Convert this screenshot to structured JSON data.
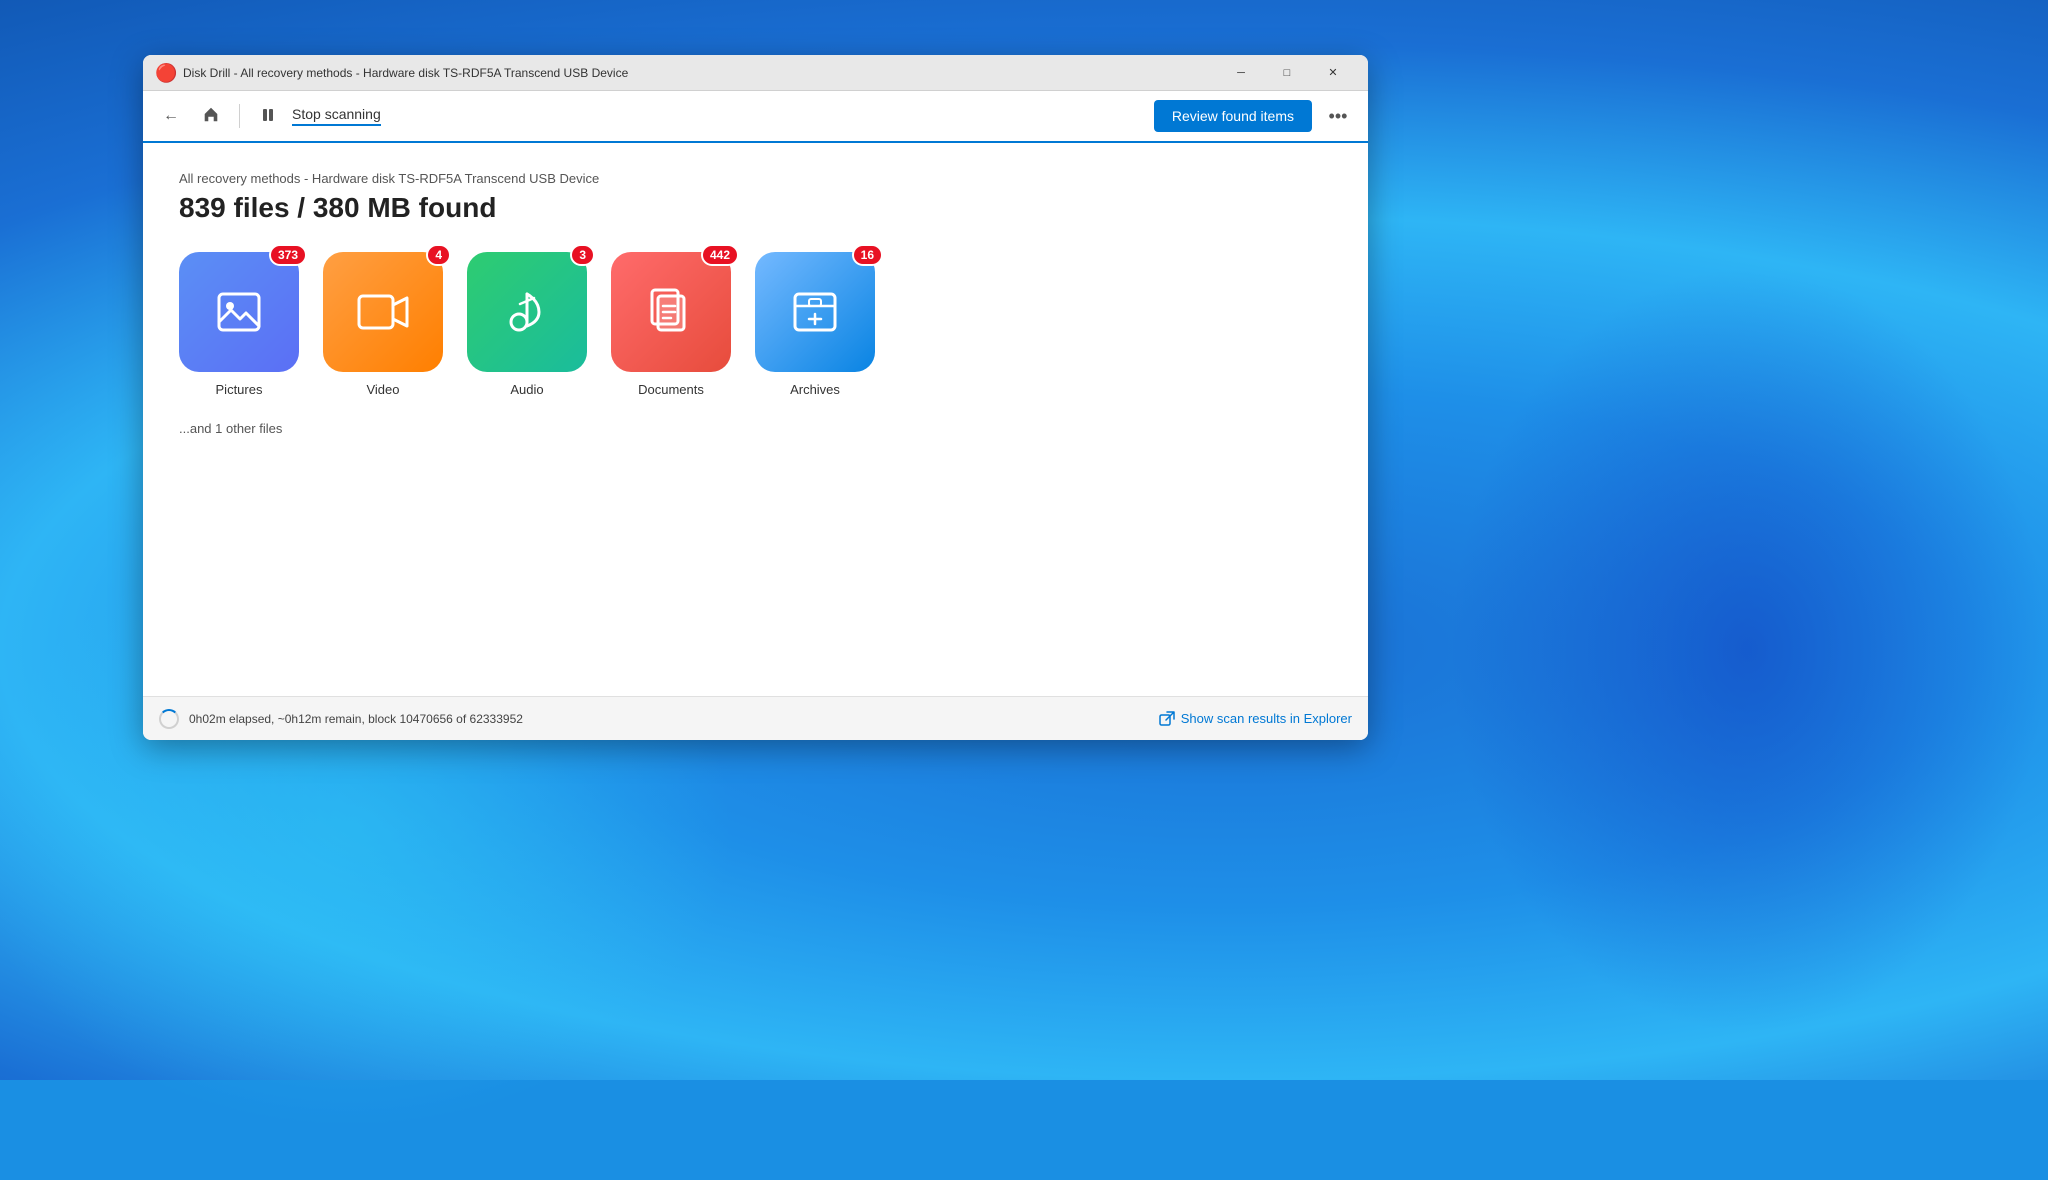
{
  "window": {
    "title": "Disk Drill - All recovery methods - Hardware disk TS-RDF5A Transcend USB Device",
    "app_icon": "🔴",
    "minimize_label": "─",
    "maximize_label": "□",
    "close_label": "✕"
  },
  "toolbar": {
    "back_icon": "←",
    "home_icon": "⌂",
    "divider": true,
    "pause_icon": "⏸",
    "stop_scanning_label": "Stop scanning",
    "review_button_label": "Review found items",
    "more_icon": "•••"
  },
  "main": {
    "subtitle": "All recovery methods - Hardware disk TS-RDF5A Transcend USB Device",
    "headline": "839 files / 380 MB found",
    "categories": [
      {
        "id": "pictures",
        "label": "Pictures",
        "badge": "373",
        "bg_class": "bg-pictures",
        "icon": "picture"
      },
      {
        "id": "video",
        "label": "Video",
        "badge": "4",
        "bg_class": "bg-video",
        "icon": "video"
      },
      {
        "id": "audio",
        "label": "Audio",
        "badge": "3",
        "bg_class": "bg-audio",
        "icon": "audio"
      },
      {
        "id": "documents",
        "label": "Documents",
        "badge": "442",
        "bg_class": "bg-documents",
        "icon": "documents"
      },
      {
        "id": "archives",
        "label": "Archives",
        "badge": "16",
        "bg_class": "bg-archives",
        "icon": "archives"
      }
    ],
    "other_files_text": "...and 1 other files"
  },
  "status": {
    "text": "0h02m elapsed, ~0h12m remain, block 10470656 of 62333952",
    "show_results_label": "Show scan results in Explorer"
  }
}
